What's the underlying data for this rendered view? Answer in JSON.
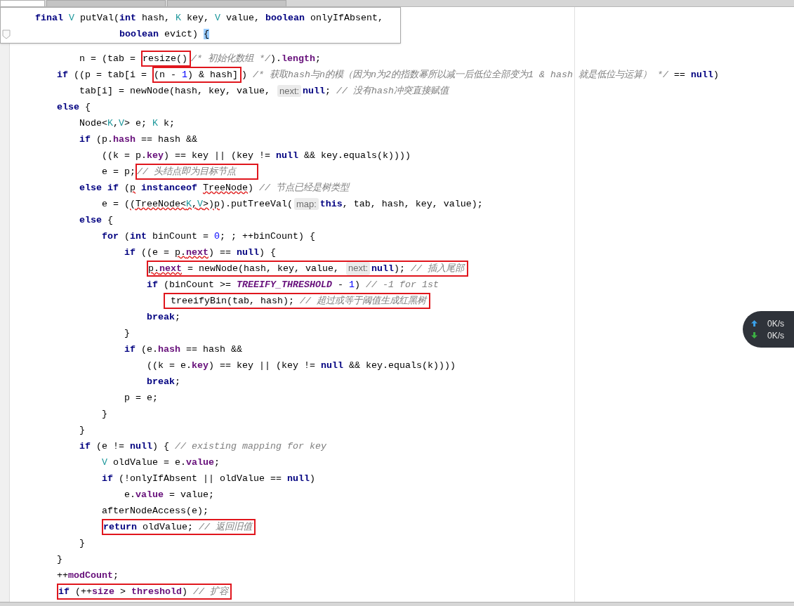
{
  "editor_tabs": [
    {
      "selected": true
    },
    {
      "selected": false
    },
    {
      "selected": false
    }
  ],
  "signature_popup": {
    "lines": [
      [
        {
          "text": "    final",
          "kind": "keyword"
        },
        {
          "text": " V",
          "kind": "type"
        },
        {
          "text": " putVal("
        },
        {
          "text": "int",
          "kind": "keyword"
        },
        {
          "text": " hash, "
        },
        {
          "text": "K",
          "kind": "type"
        },
        {
          "text": " key, "
        },
        {
          "text": "V",
          "kind": "type"
        },
        {
          "text": " value, "
        },
        {
          "text": "boolean",
          "kind": "keyword"
        },
        {
          "text": " onlyIfAbsent,"
        }
      ],
      [
        {
          "text": "                   boolean",
          "kind": "keyword"
        },
        {
          "text": " evict) "
        },
        {
          "text": "{",
          "kind": "brace_match"
        }
      ]
    ]
  },
  "code_lines": [
    [
      {
        "text": "            n = (tab = "
      },
      {
        "kind": "box",
        "tokens": [
          {
            "text": "resize()"
          }
        ]
      },
      {
        "text": "/* 初始化数组 */",
        "kind": "comment"
      },
      {
        "text": ")."
      },
      {
        "text": "length",
        "kind": "field"
      },
      {
        "text": ";"
      }
    ],
    [
      {
        "text": "        if",
        "kind": "keyword"
      },
      {
        "text": " ((p = tab[i = "
      },
      {
        "kind": "box",
        "tokens": [
          {
            "text": "(n - "
          },
          {
            "text": "1",
            "kind": "number"
          },
          {
            "text": ") & hash]"
          }
        ]
      },
      {
        "text": ") "
      },
      {
        "text": "/* 获取hash与n的模（因为n为2的指数幂所以减一后低位全部变为1 & hash 就是低位与运算） */",
        "kind": "comment"
      },
      {
        "text": " == "
      },
      {
        "text": "null",
        "kind": "keyword"
      },
      {
        "text": ")"
      }
    ],
    [
      {
        "text": "            tab[i] = newNode(hash, key, value, "
      },
      {
        "text": "next:",
        "kind": "hint"
      },
      {
        "text": "null",
        "kind": "keyword"
      },
      {
        "text": "; "
      },
      {
        "text": "// 没有hash冲突直接赋值",
        "kind": "comment"
      }
    ],
    [
      {
        "text": "        else",
        "kind": "keyword"
      },
      {
        "text": " {"
      }
    ],
    [
      {
        "text": "            Node<"
      },
      {
        "text": "K",
        "kind": "type"
      },
      {
        "text": ","
      },
      {
        "text": "V",
        "kind": "type"
      },
      {
        "text": "> e; "
      },
      {
        "text": "K",
        "kind": "type"
      },
      {
        "text": " k;"
      }
    ],
    [
      {
        "text": "            if",
        "kind": "keyword"
      },
      {
        "text": " (p."
      },
      {
        "text": "hash",
        "kind": "field"
      },
      {
        "text": " == hash &&"
      }
    ],
    [
      {
        "text": "                ((k = p."
      },
      {
        "text": "key",
        "kind": "field"
      },
      {
        "text": ") == key || (key != "
      },
      {
        "text": "null",
        "kind": "keyword"
      },
      {
        "text": " && key.equals(k))))"
      }
    ],
    [
      {
        "text": "                e = p;"
      },
      {
        "kind": "box",
        "tokens": [
          {
            "text": "// 头结点即为目标节点",
            "kind": "comment"
          }
        ]
      }
    ],
    [
      {
        "text": "            else if",
        "kind": "keyword"
      },
      {
        "text": " ("
      },
      {
        "text": "p",
        "squiggle": true
      },
      {
        "text": " instanceof ",
        "kind": "keyword"
      },
      {
        "text": "TreeNode",
        "squiggle": true
      },
      {
        "text": ") "
      },
      {
        "text": "// 节点已经是树类型",
        "kind": "comment"
      }
    ],
    [
      {
        "text": "                e = ("
      },
      {
        "text": "(TreeNode<",
        "squiggle": true
      },
      {
        "text": "K",
        "kind": "type",
        "squiggle": true
      },
      {
        "text": ",",
        "squiggle": true
      },
      {
        "text": "V",
        "kind": "type",
        "squiggle": true
      },
      {
        "text": ">)p",
        "squiggle": true
      },
      {
        "text": ").putTreeVal("
      },
      {
        "text": "map:",
        "kind": "hint"
      },
      {
        "text": "this",
        "kind": "keyword"
      },
      {
        "text": ", tab, hash, key, value);"
      }
    ],
    [
      {
        "text": "            else",
        "kind": "keyword"
      },
      {
        "text": " {"
      }
    ],
    [
      {
        "text": "                for",
        "kind": "keyword"
      },
      {
        "text": " ("
      },
      {
        "text": "int",
        "kind": "keyword"
      },
      {
        "text": " binCount = "
      },
      {
        "text": "0",
        "kind": "number"
      },
      {
        "text": "; ; ++binCount) {"
      }
    ],
    [
      {
        "text": "                    if",
        "kind": "keyword"
      },
      {
        "text": " ((e = "
      },
      {
        "text": "p.",
        "squiggle": true
      },
      {
        "text": "next",
        "kind": "field",
        "squiggle": true
      },
      {
        "text": ") == "
      },
      {
        "text": "null",
        "kind": "keyword"
      },
      {
        "text": ") {"
      }
    ],
    [
      {
        "kind": "box",
        "tokens": [
          {
            "text": "                        p.",
            "squiggle": true
          },
          {
            "text": "next",
            "kind": "field",
            "squiggle": true
          },
          {
            "text": " = newNode(hash, key, value, "
          },
          {
            "text": "next:",
            "kind": "hint"
          },
          {
            "text": "null",
            "kind": "keyword"
          },
          {
            "text": "); "
          },
          {
            "text": "// 插入尾部",
            "kind": "comment"
          }
        ]
      }
    ],
    [
      {
        "text": "                        if",
        "kind": "keyword"
      },
      {
        "text": " (binCount >= "
      },
      {
        "text": "TREEIFY_THRESHOLD",
        "kind": "constant"
      },
      {
        "text": " - "
      },
      {
        "text": "1",
        "kind": "number"
      },
      {
        "text": ") "
      },
      {
        "text": "// -1 for 1st",
        "kind": "comment"
      }
    ],
    [
      {
        "kind": "box",
        "tokens": [
          {
            "text": "                            treeifyBin(tab, hash); "
          },
          {
            "text": "// 超过或等于阈值生成红黑树",
            "kind": "comment"
          }
        ]
      }
    ],
    [
      {
        "text": "                        break",
        "kind": "keyword"
      },
      {
        "text": ";"
      }
    ],
    [
      {
        "text": "                    }"
      }
    ],
    [
      {
        "text": "                    if",
        "kind": "keyword"
      },
      {
        "text": " (e."
      },
      {
        "text": "hash",
        "kind": "field"
      },
      {
        "text": " == hash &&"
      }
    ],
    [
      {
        "text": "                        ((k = e."
      },
      {
        "text": "key",
        "kind": "field"
      },
      {
        "text": ") == key || (key != "
      },
      {
        "text": "null",
        "kind": "keyword"
      },
      {
        "text": " && key.equals(k))))"
      }
    ],
    [
      {
        "text": "                        break",
        "kind": "keyword"
      },
      {
        "text": ";"
      }
    ],
    [
      {
        "text": "                    p = e;"
      }
    ],
    [
      {
        "text": "                }"
      }
    ],
    [
      {
        "text": "            }"
      }
    ],
    [
      {
        "text": "            if",
        "kind": "keyword"
      },
      {
        "text": " (e != "
      },
      {
        "text": "null",
        "kind": "keyword"
      },
      {
        "text": ") { "
      },
      {
        "text": "// existing mapping for key",
        "kind": "comment"
      }
    ],
    [
      {
        "text": "                V",
        "kind": "type"
      },
      {
        "text": " oldValue = e."
      },
      {
        "text": "value",
        "kind": "field"
      },
      {
        "text": ";"
      }
    ],
    [
      {
        "text": "                if",
        "kind": "keyword"
      },
      {
        "text": " (!onlyIfAbsent || oldValue == "
      },
      {
        "text": "null",
        "kind": "keyword"
      },
      {
        "text": ")"
      }
    ],
    [
      {
        "text": "                    e."
      },
      {
        "text": "value",
        "kind": "field"
      },
      {
        "text": " = value;"
      }
    ],
    [
      {
        "text": "                afterNodeAccess(e);"
      }
    ],
    [
      {
        "kind": "box",
        "tokens": [
          {
            "text": "                return",
            "kind": "keyword"
          },
          {
            "text": " oldValue; "
          },
          {
            "text": "// 返回旧值",
            "kind": "comment"
          }
        ]
      }
    ],
    [
      {
        "text": "            }"
      }
    ],
    [
      {
        "text": "        }"
      }
    ],
    [
      {
        "text": "        ++"
      },
      {
        "text": "modCount",
        "kind": "field"
      },
      {
        "text": ";"
      }
    ],
    [
      {
        "kind": "box",
        "tokens": [
          {
            "text": "        if",
            "kind": "keyword"
          },
          {
            "text": " (++"
          },
          {
            "text": "size",
            "kind": "field"
          },
          {
            "text": " > "
          },
          {
            "text": "threshold",
            "kind": "field"
          },
          {
            "text": ") "
          },
          {
            "text": "// 扩容",
            "kind": "comment"
          }
        ]
      }
    ]
  ],
  "net_monitor": [
    {
      "kind": "upload",
      "reading": "0K/s"
    },
    {
      "kind": "download",
      "reading": "0K/s"
    }
  ]
}
